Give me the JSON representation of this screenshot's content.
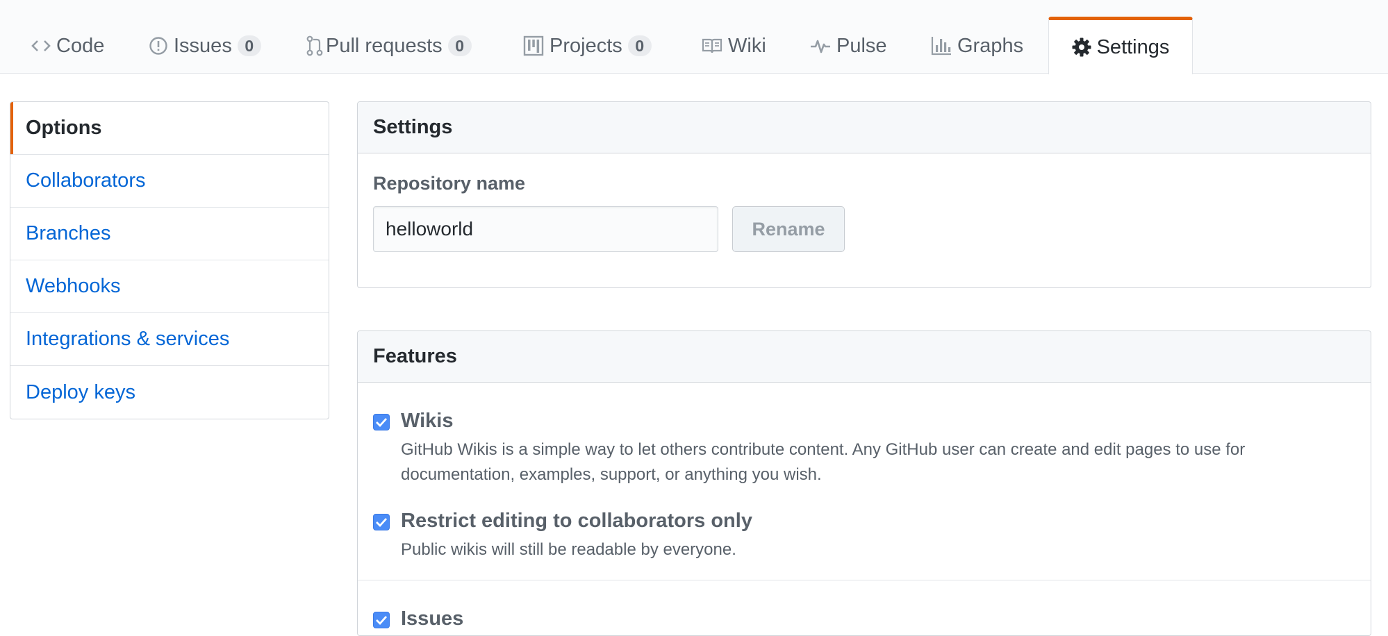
{
  "nav": {
    "tabs": [
      {
        "label": "Code",
        "icon": "code-icon"
      },
      {
        "label": "Issues",
        "count": "0",
        "icon": "issue-icon"
      },
      {
        "label": "Pull requests",
        "count": "0",
        "icon": "pull-request-icon"
      },
      {
        "label": "Projects",
        "count": "0",
        "icon": "project-icon"
      },
      {
        "label": "Wiki",
        "icon": "book-icon"
      },
      {
        "label": "Pulse",
        "icon": "pulse-icon"
      },
      {
        "label": "Graphs",
        "icon": "graph-icon"
      },
      {
        "label": "Settings",
        "icon": "gear-icon",
        "selected": true
      }
    ],
    "accent_color": "#e36209"
  },
  "sidebar": {
    "items": [
      {
        "label": "Options",
        "selected": true
      },
      {
        "label": "Collaborators"
      },
      {
        "label": "Branches"
      },
      {
        "label": "Webhooks"
      },
      {
        "label": "Integrations & services"
      },
      {
        "label": "Deploy keys"
      }
    ]
  },
  "settings": {
    "title": "Settings",
    "repo_name_label": "Repository name",
    "repo_name_value": "helloworld",
    "rename_label": "Rename"
  },
  "features": {
    "title": "Features",
    "items": [
      {
        "label": "Wikis",
        "checked": true,
        "desc_line1": "GitHub Wikis is a simple way to let others contribute content. Any GitHub user can create and edit pages to use for",
        "desc_line2": "documentation, examples, support, or anything you wish."
      },
      {
        "label": "Restrict editing to collaborators only",
        "checked": true,
        "desc_line1": "Public wikis will still be readable by everyone."
      },
      {
        "label": "Issues",
        "checked": true
      }
    ]
  },
  "colors": {
    "link": "#0366d6",
    "checkbox": "#4a8cf7"
  }
}
